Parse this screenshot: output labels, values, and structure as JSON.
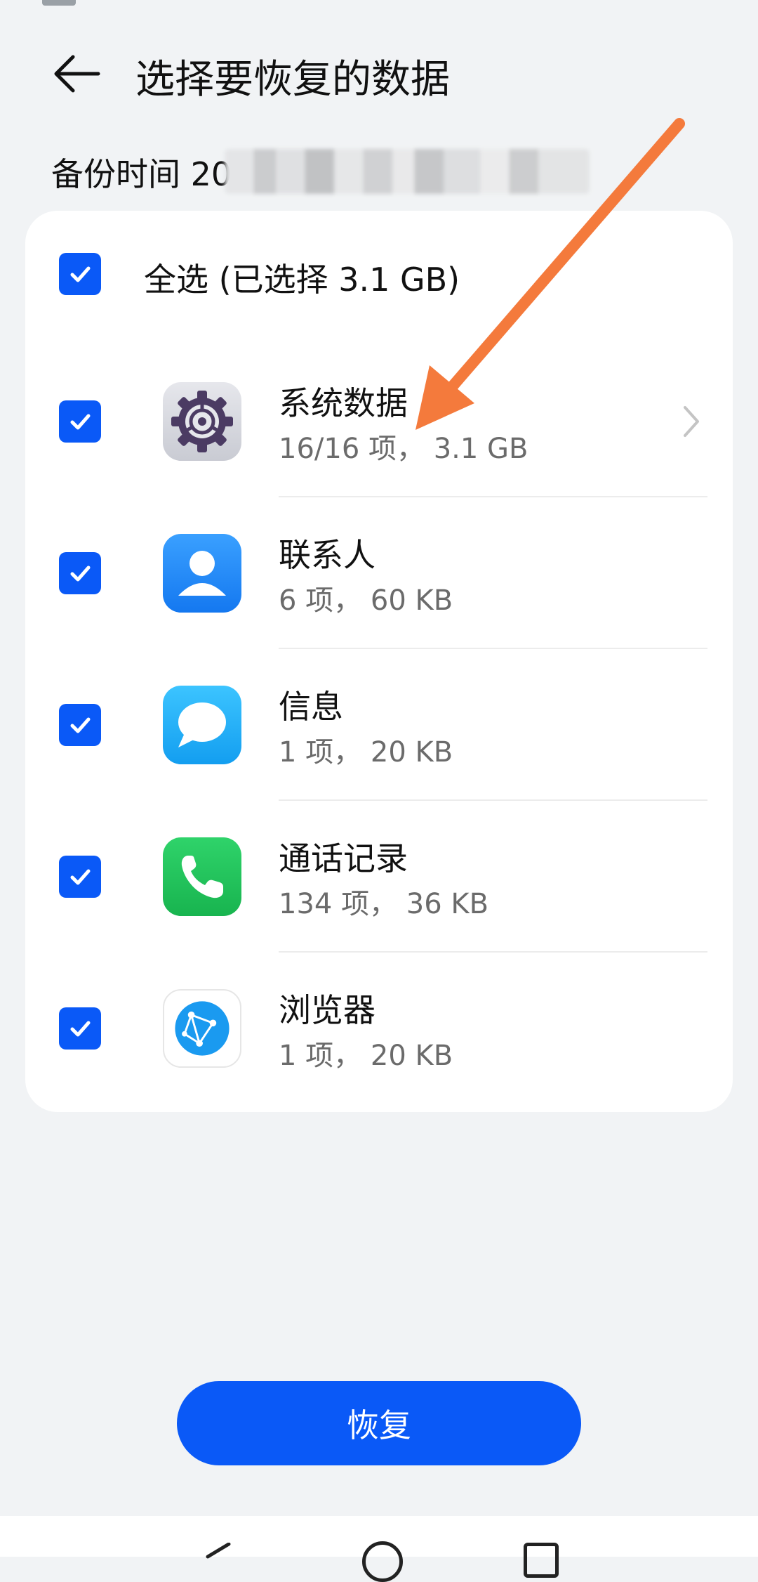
{
  "header": {
    "title": "选择要恢复的数据",
    "back_icon": "arrow-left-icon"
  },
  "backup": {
    "label": "备份时间 20"
  },
  "select_all": {
    "label": "全选 (已选择 3.1 GB)",
    "checked": true
  },
  "items": [
    {
      "name": "系统数据",
      "detail": "16/16 项，  3.1 GB",
      "icon": "settings-gear-icon",
      "checked": true,
      "has_chevron": true
    },
    {
      "name": "联系人",
      "detail": "6 项，  60 KB",
      "icon": "contacts-icon",
      "checked": true
    },
    {
      "name": "信息",
      "detail": "1 项，  20 KB",
      "icon": "messages-icon",
      "checked": true
    },
    {
      "name": "通话记录",
      "detail": "134 项，  36 KB",
      "icon": "phone-icon",
      "checked": true
    },
    {
      "name": "浏览器",
      "detail": "1 项，  20 KB",
      "icon": "browser-icon",
      "checked": true
    }
  ],
  "restore_button": {
    "label": "恢复"
  },
  "colors": {
    "accent": "#0a59f7",
    "annotation_arrow": "#f47a3c",
    "background": "#f1f3f5"
  }
}
